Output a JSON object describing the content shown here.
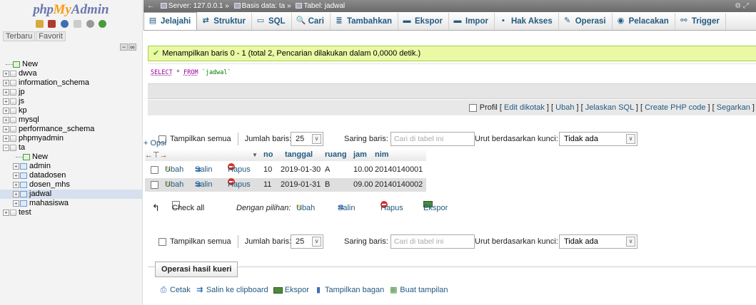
{
  "logo": {
    "php": "php",
    "my": "My",
    "admin": "Admin"
  },
  "nav_tabs": [
    "Terbaru",
    "Favorit"
  ],
  "tree": [
    {
      "name": "New",
      "level": 0,
      "kind": "new"
    },
    {
      "name": "dwva",
      "level": 0,
      "kind": "db"
    },
    {
      "name": "information_schema",
      "level": 0,
      "kind": "db"
    },
    {
      "name": "jp",
      "level": 0,
      "kind": "db"
    },
    {
      "name": "js",
      "level": 0,
      "kind": "db"
    },
    {
      "name": "kp",
      "level": 0,
      "kind": "db"
    },
    {
      "name": "mysql",
      "level": 0,
      "kind": "db"
    },
    {
      "name": "performance_schema",
      "level": 0,
      "kind": "db"
    },
    {
      "name": "phpmyadmin",
      "level": 0,
      "kind": "db"
    },
    {
      "name": "ta",
      "level": 0,
      "kind": "db-open"
    },
    {
      "name": "New",
      "level": 1,
      "kind": "new"
    },
    {
      "name": "admin",
      "level": 1,
      "kind": "table"
    },
    {
      "name": "datadosen",
      "level": 1,
      "kind": "table"
    },
    {
      "name": "dosen_mhs",
      "level": 1,
      "kind": "table"
    },
    {
      "name": "jadwal",
      "level": 1,
      "kind": "table",
      "selected": true
    },
    {
      "name": "mahasiswa",
      "level": 1,
      "kind": "table"
    },
    {
      "name": "test",
      "level": 0,
      "kind": "db"
    }
  ],
  "breadcrumb": {
    "server": "Server: 127.0.0.1",
    "database": "Basis data: ta",
    "table": "Tabel: jadwal"
  },
  "tabs": [
    {
      "label": "Jelajahi",
      "icon": "browse-icon",
      "glyph": "▤"
    },
    {
      "label": "Struktur",
      "icon": "structure-icon",
      "glyph": "⇄"
    },
    {
      "label": "SQL",
      "icon": "sql-icon",
      "glyph": "▭"
    },
    {
      "label": "Cari",
      "icon": "search-icon",
      "glyph": "🔍"
    },
    {
      "label": "Tambahkan",
      "icon": "insert-icon",
      "glyph": "≣"
    },
    {
      "label": "Ekspor",
      "icon": "export-icon",
      "glyph": "▬"
    },
    {
      "label": "Impor",
      "icon": "import-icon",
      "glyph": "▬"
    },
    {
      "label": "Hak Akses",
      "icon": "privileges-icon",
      "glyph": "▪"
    },
    {
      "label": "Operasi",
      "icon": "operations-icon",
      "glyph": "✎"
    },
    {
      "label": "Pelacakan",
      "icon": "tracking-icon",
      "glyph": "◉"
    },
    {
      "label": "Trigger",
      "icon": "trigger-icon",
      "glyph": "⚯"
    }
  ],
  "message": "Menampilkan baris 0 - 1 (total 2, Pencarian dilakukan dalam 0,0000 detik.)",
  "sql": {
    "select": "SELECT",
    "star": "*",
    "from": "FROM",
    "table": "`jadwal`"
  },
  "profile": {
    "label": "Profil",
    "links": [
      "Edit dikotak",
      "Ubah",
      "Jelaskan SQL",
      "Create PHP code",
      "Segarkan"
    ]
  },
  "navrow": {
    "show_all": "Tampilkan semua",
    "rows_label": "Jumlah baris:",
    "rows_value": "25",
    "filter_label": "Saring baris:",
    "filter_placeholder": "Cari di tabel ini",
    "sort_label": "Urut berdasarkan kunci:",
    "sort_value": "Tidak ada"
  },
  "options_link": "+ Opsi",
  "columns": [
    "no",
    "tanggal",
    "ruang",
    "jam",
    "nim"
  ],
  "row_actions": {
    "edit": "Ubah",
    "copy": "Salin",
    "delete": "Hapus"
  },
  "rows": [
    {
      "no": "10",
      "tanggal": "2019-01-30",
      "ruang": "A",
      "jam": "10.00",
      "nim": "20140140001"
    },
    {
      "no": "11",
      "tanggal": "2019-01-31",
      "ruang": "B",
      "jam": "09.00",
      "nim": "20140140002"
    }
  ],
  "bulk": {
    "check_all": "Check all",
    "with_selected": "Dengan pilihan:",
    "edit": "Ubah",
    "copy": "Salin",
    "delete": "Hapus",
    "export": "Ekspor"
  },
  "query_ops": {
    "title": "Operasi hasil kueri",
    "print": "Cetak",
    "copy_clipboard": "Salin ke clipboard",
    "export": "Ekspor",
    "chart": "Tampilkan bagan",
    "create_view": "Buat tampilan"
  }
}
